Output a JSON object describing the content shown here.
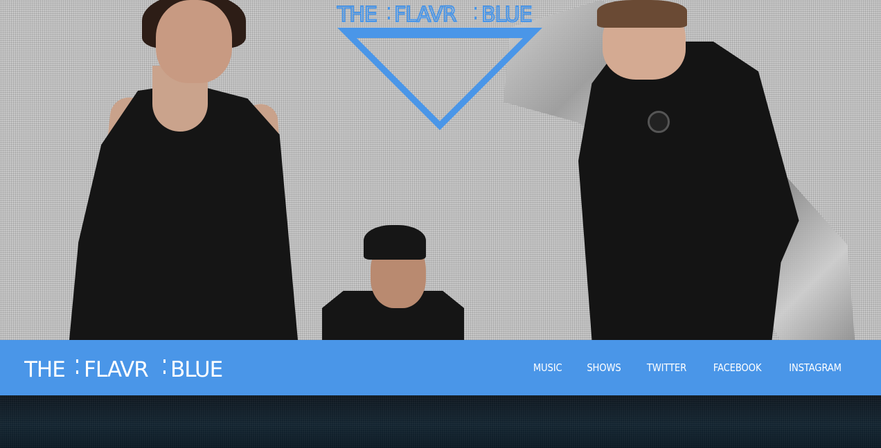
{
  "site": {
    "logo_text": "THE FLAVR BLUE",
    "logo_parts": [
      "THE",
      "FLAVR",
      "BLUE"
    ],
    "brand_color": "#4a96e8"
  },
  "hero": {
    "logo_parts": [
      "THE",
      "FLAVR",
      "BLUE"
    ],
    "logo_color": "#4a96e8"
  },
  "nav": {
    "items": [
      {
        "label": "MUSIC"
      },
      {
        "label": "SHOWS"
      },
      {
        "label": "TWITTER"
      },
      {
        "label": "FACEBOOK"
      },
      {
        "label": "INSTAGRAM"
      }
    ]
  }
}
